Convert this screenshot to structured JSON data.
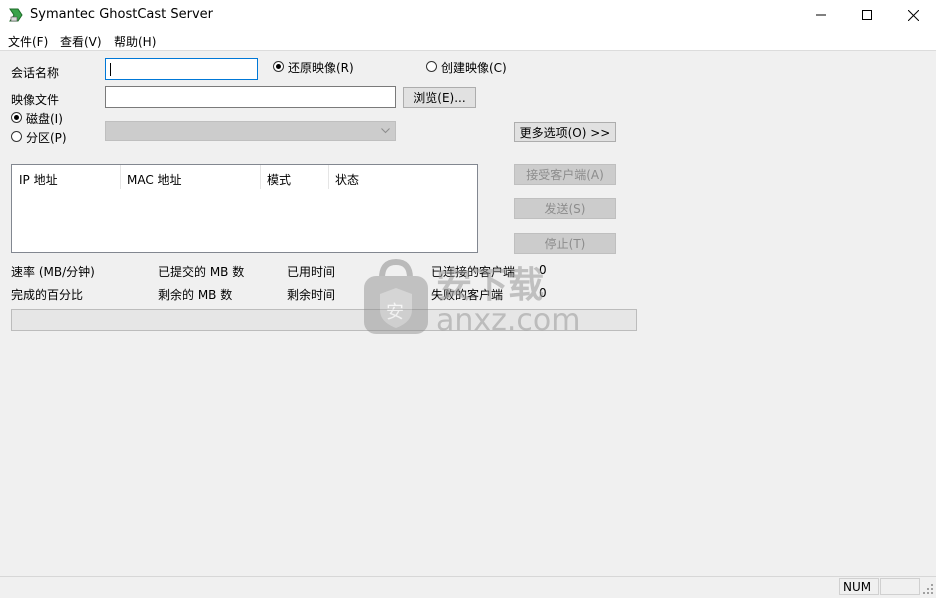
{
  "window": {
    "title": "Symantec GhostCast Server",
    "controls": {
      "minimize": "—",
      "maximize": "☐",
      "close": "✕"
    }
  },
  "menu": [
    "文件(F)",
    "查看(V)",
    "帮助(H)"
  ],
  "form": {
    "session_label": "会话名称",
    "session_value": "",
    "image_file_label": "映像文件",
    "image_file_value": "",
    "browse_button": "浏览(E)...",
    "restore_image_label": "还原映像(R)",
    "create_image_label": "创建映像(C)",
    "disk_label": "磁盘(I)",
    "partition_label": "分区(P)",
    "partition_combo_value": "",
    "more_options_button": "更多选项(O) >>"
  },
  "clients_table": {
    "columns": [
      "IP 地址",
      "MAC 地址",
      "模式",
      "状态"
    ],
    "rows": []
  },
  "actions": {
    "accept_clients": "接受客户端(A)",
    "send": "发送(S)",
    "stop": "停止(T)"
  },
  "stats": {
    "rate_label": "速率 (MB/分钟)",
    "submitted_label": "已提交的 MB 数",
    "elapsed_label": "已用时间",
    "connected_label": "已连接的客户端",
    "connected_value": "0",
    "percent_label": "完成的百分比",
    "remaining_mb_label": "剩余的 MB 数",
    "remaining_time_label": "剩余时间",
    "failed_label": "失败的客户端",
    "failed_value": "0",
    "progress_fraction": 0
  },
  "statusbar": {
    "num": "NUM"
  },
  "watermark": {
    "logo_char": "安",
    "text_cn": "安下载",
    "text_domain": "anxz.com"
  },
  "colors": {
    "focus_border": "#0078d7",
    "disabled_button": "#cccccc"
  }
}
